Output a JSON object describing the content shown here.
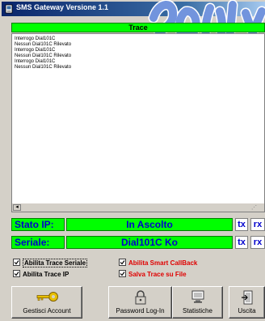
{
  "window": {
    "title": "SMS Gateway Versione 1.1"
  },
  "trace": {
    "header": "Trace",
    "lines": [
      "Interrogo Dial101C",
      "Nessun Dial101C Rilevato",
      "Interrogo Dial101C",
      "Nessun Dial101C Rilevato",
      "Interrogo Dial101C",
      "Nessun Dial101C Rilevato"
    ]
  },
  "status": {
    "ip_label": "Stato IP:",
    "ip_value": "In Ascolto",
    "serial_label": "Seriale:",
    "serial_value": "Dial101C Ko",
    "tx": "tx",
    "rx": "rx"
  },
  "options": {
    "trace_seriale": {
      "label": "Abilita Trace Seriale",
      "checked": true
    },
    "trace_ip": {
      "label": "Abilita Trace IP",
      "checked": true
    },
    "smart_callback": {
      "label": "Abilita Smart CallBack",
      "checked": true
    },
    "salva_trace": {
      "label": "Salva Trace su File",
      "checked": true
    }
  },
  "buttons": {
    "account": "Gestisci Account",
    "password": "Password Log-In",
    "stats": "Statistiche",
    "exit": "Uscita"
  },
  "icons": {
    "app": "app-icon",
    "account": "key-icon",
    "password": "padlock-icon",
    "stats": "monitor-icon",
    "exit": "exit-door-icon"
  },
  "colors": {
    "status_green": "#00ff00",
    "status_text": "#0000cc",
    "check_red": "#e00000",
    "title_bar": "#0a246a"
  }
}
